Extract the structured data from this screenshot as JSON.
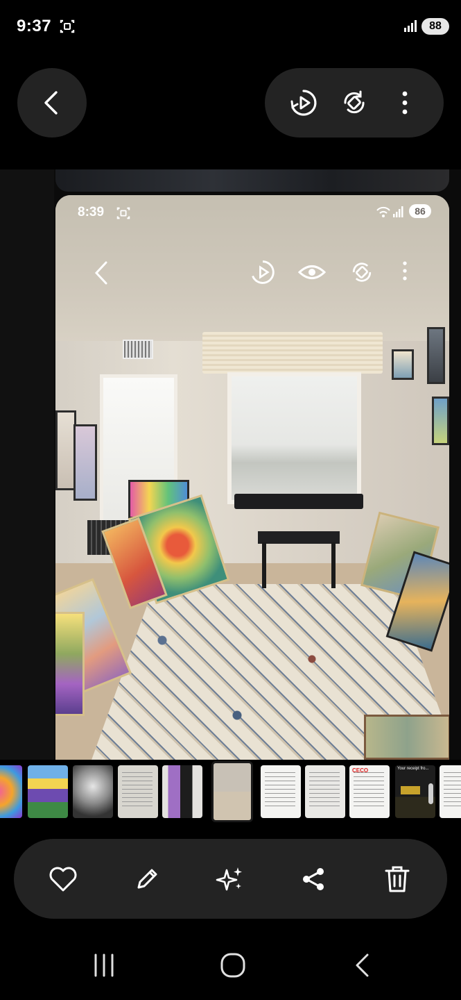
{
  "status_bar": {
    "time": "9:37",
    "battery": "88",
    "icons": [
      "screenshot-icon",
      "signal-icon"
    ]
  },
  "top_bar": {
    "back_icon": "chevron-left-icon",
    "actions": [
      "motion-play-icon",
      "auto-rotate-icon",
      "more-vertical-icon"
    ]
  },
  "photo": {
    "embedded_status": {
      "time": "8:39",
      "battery": "86"
    },
    "embedded_toolbar": [
      "chevron-left-icon",
      "motion-play-icon",
      "eye-icon",
      "auto-rotate-icon",
      "more-vertical-icon"
    ]
  },
  "filmstrip": {
    "thumbnails": [
      "colorful-painting",
      "lavender-painting",
      "portrait-sketch",
      "document",
      "two-people-photo",
      "room-photo",
      "document",
      "document",
      "ceco-document",
      "receipt-dark",
      "document"
    ],
    "current_index": 5,
    "thumb_texts": {
      "ceco": "CECO",
      "receipt": "Your receipt fro..."
    }
  },
  "bottom_actions": [
    "heart-icon",
    "edit-pencil-icon",
    "ai-sparkle-icon",
    "share-icon",
    "trash-icon"
  ],
  "nav_bar": [
    "recents-icon",
    "home-icon",
    "back-icon"
  ],
  "colors": {
    "background": "#000000",
    "pill": "#232323",
    "icon": "#ffffff"
  }
}
